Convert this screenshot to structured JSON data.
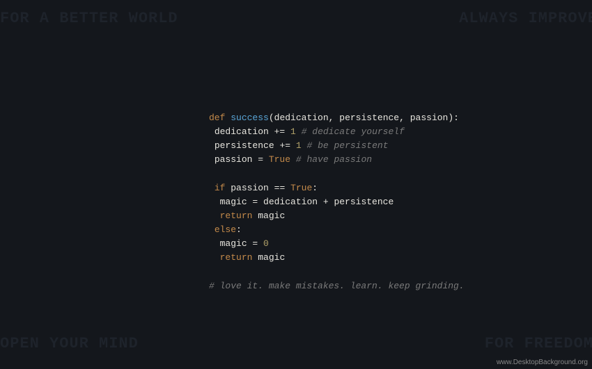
{
  "background_text": {
    "top_left": "FOR A BETTER WORLD",
    "top_right": "ALWAYS IMPROVE",
    "bottom_left": "OPEN YOUR MIND",
    "bottom_right": "FOR FREEDOM"
  },
  "code": {
    "kw_def": "def",
    "fn_name": "success",
    "paren_open": "(",
    "param1": "dedication",
    "comma1": ",",
    "param2": "persistence",
    "comma2": ",",
    "param3": "passion",
    "paren_close_colon": "):",
    "line2_id": "dedication",
    "line2_op": " += ",
    "line2_num": "1",
    "line2_cmt": " # dedicate yourself",
    "line3_id": "persistence",
    "line3_op": " += ",
    "line3_num": "1",
    "line3_cmt": " # be persistent",
    "line4_id": "passion",
    "line4_op": " = ",
    "line4_bool": "True",
    "line4_cmt": " # have passion",
    "kw_if": "if",
    "if_id": "passion",
    "if_op": " == ",
    "if_bool": "True",
    "if_colon": ":",
    "line7_id": "magic",
    "line7_op": " = ",
    "line7_rhs1": "dedication",
    "line7_plus": " + ",
    "line7_rhs2": "persistence",
    "kw_return1": "return",
    "return1_id": "magic",
    "kw_else": "else",
    "else_colon": ":",
    "line10_id": "magic",
    "line10_op": " = ",
    "line10_num": "0",
    "kw_return2": "return",
    "return2_id": "magic",
    "footer": "# love it. make mistakes. learn. keep grinding."
  },
  "watermark": "www.DesktopBackground.org"
}
